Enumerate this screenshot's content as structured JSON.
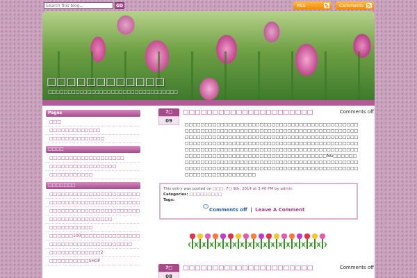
{
  "search": {
    "placeholder": "Search this blog...",
    "go_label": "GO"
  },
  "feeds": {
    "rss_label": "RSS",
    "comments_label": "Comments"
  },
  "site": {
    "title": "□□□□□□□□□□□□",
    "tagline": "□□□□□□□□□□□□□□□□□□□□□□□□□□□□□□□□□"
  },
  "sidebar": {
    "widgets": [
      {
        "title": "Pages",
        "items": [
          "□□□",
          "□□□□□□□□□□□□□",
          "□□□□□□□□□□□□□□"
        ]
      },
      {
        "title": "□□□□",
        "items": [
          "□□□□□□□□□□□□□□□□□□□",
          "□□□□□□□□□□□□□□□□□",
          "□□□□□□□□□□□"
        ]
      },
      {
        "title": "□□□□□□□",
        "items": [
          "□□□□□□□□□□□□□□□□□□□□□□□□□□□□",
          "□□□□□□□□□□□□□□□□□□□□□□□□□□□□□□□□",
          "□□□□□□□□□□□□□□□□□□□□□□□□□",
          "□□□□□□□□□□□□□□□□",
          "□□□□□□□□□□□",
          "□□□□□□100□□□□□□□□□□□□□□□",
          "□□□□□□□□□□□□□□□□□□□□□",
          "□□□□□□□□□□□□□2",
          "□□□□□□□□□□SHOP"
        ]
      }
    ]
  },
  "posts": [
    {
      "month": "7□",
      "day": "09",
      "title": "□□□□□□□□□□□□□□□□□□□□□□",
      "comments_status": "Comments off",
      "body": "□□□□□□□□□□□□□□□□□□□□□□□□□□□□□□□□□□□□□□□□□□□□□□□□□□□□□□□□□□□□□□□□□□□□□□□□□□□□□□□□□□□□□□□□□□□□□□□□□□□□□□□□□□□□□□□□□□□□□□□□□□□□□□□□□□□□□□□□□□□□□□□□□□□□□□□□□□□□□□□□□□□□□□□□□□□□□□□□□□□□□□□□□□□□□□□□□□□□□□□□□□□□□□□□□□□□□□□□□□□□□□□□□□□□□□□□□□□□□□□□□□□□□□□□□□□□□□□□NG□□□□□□□□□□□□□□□□□□□□□□□□□□□□□□□□□□□□□□□□□□□□□□□□□□□□□□□□□□□□□□□□□□□□□□□□□□□□□□□□□□□□□□□□□□□□□□□□□□□□□□□□□□□□□□□□",
      "meta": {
        "posted_prefix": "This entry was posted on",
        "posted_date": "□□□, 7□ 9th, 2014 at 3:40 PM",
        "by_prefix": "by",
        "author": "admin",
        "categories_label": "Categories:",
        "category": "□□□□□□□□□",
        "tags_label": "Tags:",
        "comments_link": "Comments off",
        "separator": "|",
        "leave_comment": "Leave A Comment"
      }
    },
    {
      "month": "7□",
      "day": "08",
      "title": "□□□□□□□□□□□□□□□□□□□□□□",
      "comments_status": "Comments off"
    }
  ],
  "colors": {
    "accent": "#a03d84",
    "feed_orange": "#f08a00",
    "page_pattern": "#c9a3bd"
  },
  "divider_tulip_colors": [
    "#e2334d",
    "#f6c531",
    "#e45ab1",
    "#ff7a3a",
    "#c23bd1",
    "#e2334d",
    "#f6c531",
    "#e45ab1",
    "#ff7a3a",
    "#c23bd1",
    "#e2334d",
    "#f6c531",
    "#e45ab1",
    "#ff7a3a",
    "#c23bd1",
    "#e2334d",
    "#f6c531",
    "#e45ab1"
  ]
}
